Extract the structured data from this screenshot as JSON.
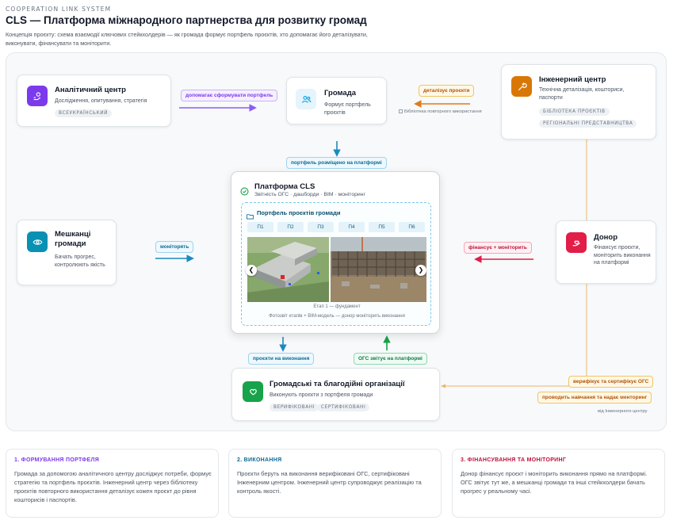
{
  "header": {
    "brand": "COOPERATION LINK SYSTEM",
    "title": "CLS — Платформа міжнародного партнерства для розвитку громад",
    "subtitle": "Концепція проєкту: схема взаємодії ключових стейкхолдерів — як громада формує портфель проєктів, хто допомагає його деталізувати, виконувати, фінансувати та моніторити."
  },
  "nodes": {
    "analytics": {
      "title": "Аналітичний центр",
      "desc": "Дослідження, опитування, стратегія",
      "chip": "ВСЕУКРАЇНСЬКИЙ",
      "icon": "gear-hand-icon",
      "color": "#7c3aed"
    },
    "community": {
      "title": "Громада",
      "desc": "Формує портфель проєктів",
      "icon": "users-icon",
      "color": "#0ea5e9"
    },
    "engineering": {
      "title": "Інженерний центр",
      "desc": "Технічна деталізація, кошториси, паспорти",
      "chips": [
        "БІБЛІОТЕКА ПРОЄКТІВ",
        "РЕГІОНАЛЬНІ ПРЕДСТАВНИЦТВА"
      ],
      "icon": "wrench-icon",
      "color": "#d97706"
    },
    "residents": {
      "title": "Мешканці громади",
      "desc": "Бачать прогрес, контролюють якість",
      "icon": "eye-icon",
      "color": "#0891b2"
    },
    "donor": {
      "title": "Донор",
      "desc": "Фінансує проєкти, моніторить виконання на платформі",
      "icon": "donate-icon",
      "color": "#e11d48"
    },
    "cso": {
      "title": "Громадські та благодійні організації",
      "desc": "Виконують проєкти з портфеля громади",
      "chips": [
        "ВЕРИФІКОВАНІ",
        "СЕРТИФІКОВАНІ"
      ],
      "icon": "heart-hand-icon",
      "color": "#16a34a"
    }
  },
  "platform": {
    "title": "Платформа CLS",
    "desc": "Звітність ОГС · дашборди · BIM · моніторинг",
    "portfolio_title": "Портфель проєктів громади",
    "tabs": [
      "П1",
      "П2",
      "П3",
      "П4",
      "П5",
      "П6"
    ],
    "caption": "Етап 1 — фундамент",
    "footer": "Фотозвіт етапів + BIM-модель — донор моніторить виконання"
  },
  "edges": {
    "analytics_to_community": "допомагає сформувати портфель",
    "engineering_to_community": "деталізує проєкти",
    "library_note": "Бібліотека повторного використання",
    "community_to_platform": "портфель розміщено на платформі",
    "platform_to_residents": "моніторять",
    "donor_to_platform": "фінансує + моніторить",
    "platform_to_cso": "проєкти на виконання",
    "cso_to_platform": "ОГС звітує на платформі",
    "eng_verify": "верифікує та сертифікує ОГС",
    "eng_training": "проводить навчання та надає менторинг",
    "eng_note": "від Інженерного центру"
  },
  "steps": [
    {
      "title": "1. ФОРМУВАННЯ ПОРТФЕЛЯ",
      "body": "Громада за допомогою аналітичного центру досліджує потреби, формує стратегію та портфель проєктів. Інженерний центр через бібліотеку проєктів повторного використання деталізує кожен проєкт до рівня кошторисів і паспортів.",
      "color": "#7c3aed"
    },
    {
      "title": "2. ВИКОНАННЯ",
      "body": "Проєкти беруть на виконання верифіковані ОГС, сертифіковані Інженерним центром. Інженерний центр супроводжує реалізацію та контроль якості.",
      "color": "#0b6b95"
    },
    {
      "title": "3. ФІНАНСУВАННЯ ТА МОНІТОРИНГ",
      "body": "Донор фінансує проєкт і моніторить виконання прямо на платформі. ОГС звітує тут же, а мешканці громади та інші стейкхолдери бачать прогрес у реальному часі.",
      "color": "#be123c"
    }
  ]
}
